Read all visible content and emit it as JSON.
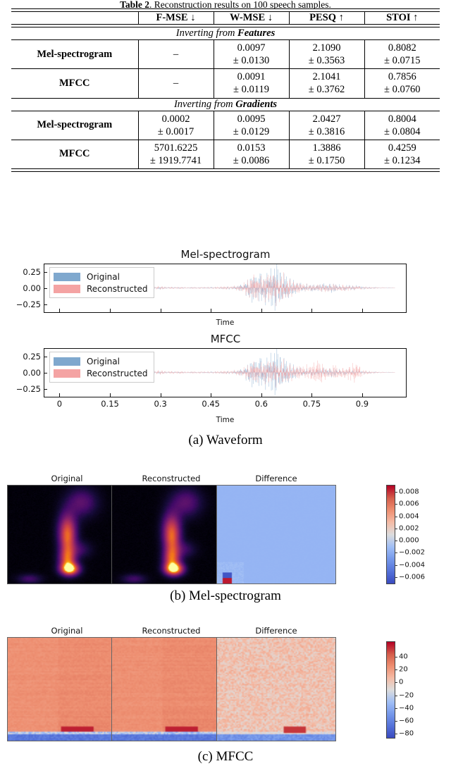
{
  "table": {
    "caption_prefix": "Table 2",
    "caption": "Table 2. Reconstruction results on 100 speech samples.",
    "columns": [
      "",
      "F-MSE ↓",
      "W-MSE ↓",
      "PESQ ↑",
      "STOI ↑"
    ],
    "sections": [
      {
        "header_plain": "Inverting from ",
        "header_bold": "Features",
        "rows": [
          {
            "label": "Mel-spectrogram",
            "cells": [
              {
                "mean": "–",
                "std": ""
              },
              {
                "mean": "0.0097",
                "std": "± 0.0130"
              },
              {
                "mean": "2.1090",
                "std": "± 0.3563"
              },
              {
                "mean": "0.8082",
                "std": "± 0.0715"
              }
            ]
          },
          {
            "label": "MFCC",
            "cells": [
              {
                "mean": "–",
                "std": ""
              },
              {
                "mean": "0.0091",
                "std": "± 0.0119"
              },
              {
                "mean": "2.1041",
                "std": "± 0.3762"
              },
              {
                "mean": "0.7856",
                "std": "± 0.0760"
              }
            ]
          }
        ]
      },
      {
        "header_plain": "Inverting from ",
        "header_bold": "Gradients",
        "rows": [
          {
            "label": "Mel-spectrogram",
            "cells": [
              {
                "mean": "0.0002",
                "std": "± 0.0017"
              },
              {
                "mean": "0.0095",
                "std": "± 0.0129"
              },
              {
                "mean": "2.0427",
                "std": "± 0.3816"
              },
              {
                "mean": "0.8004",
                "std": "± 0.0804"
              }
            ]
          },
          {
            "label": "MFCC",
            "cells": [
              {
                "mean": "5701.6225",
                "std": "± 1919.7741"
              },
              {
                "mean": "0.0153",
                "std": "± 0.0086"
              },
              {
                "mean": "1.3886",
                "std": "± 0.1750"
              },
              {
                "mean": "0.4259",
                "std": "± 0.1234"
              }
            ]
          }
        ]
      }
    ]
  },
  "figure": {
    "panel_a": {
      "caption": "(a) Waveform",
      "plots": [
        {
          "title": "Mel-spectrogram"
        },
        {
          "title": "MFCC"
        }
      ],
      "legend": [
        {
          "label": "Original",
          "color": "#7fa8ce"
        },
        {
          "label": "Reconstructed",
          "color": "#f4a3a3"
        }
      ],
      "xlabel": "Time",
      "yticks": [
        "0.25",
        "0.00",
        "−0.25"
      ],
      "xticks": [
        "0",
        "0.15",
        "0.3",
        "0.45",
        "0.6",
        "0.75",
        "0.9"
      ]
    },
    "panel_b": {
      "caption": "(b) Mel-spectrogram",
      "titles": [
        "Original",
        "Reconstructed",
        "Difference"
      ],
      "colorbar_ticks": [
        "0.008",
        "0.006",
        "0.004",
        "0.002",
        "0.000",
        "−0.002",
        "−0.004",
        "−0.006"
      ]
    },
    "panel_c": {
      "caption": "(c) MFCC",
      "titles": [
        "Original",
        "Reconstructed",
        "Difference"
      ],
      "colorbar_ticks": [
        "40",
        "20",
        "0",
        "−20",
        "−40",
        "−60",
        "−80"
      ]
    }
  },
  "chart_data": [
    {
      "type": "line",
      "id": "waveform-mel",
      "title": "Mel-spectrogram",
      "xlabel": "Time",
      "ylabel": "",
      "xlim": [
        -0.045,
        1.03
      ],
      "ylim": [
        -0.45,
        0.45
      ],
      "xticks": [
        0,
        0.15,
        0.3,
        0.45,
        0.6,
        0.75,
        0.9
      ],
      "yticks": [
        0.25,
        0.0,
        -0.25
      ],
      "grid": false,
      "legend_position": "upper left",
      "series": [
        {
          "name": "Original",
          "color": "#7fa8ce",
          "envelope_x": [
            0.0,
            0.05,
            0.1,
            0.15,
            0.2,
            0.25,
            0.28,
            0.3,
            0.32,
            0.35,
            0.38,
            0.42,
            0.46,
            0.5,
            0.53,
            0.55,
            0.57,
            0.59,
            0.61,
            0.63,
            0.645,
            0.66,
            0.68,
            0.7,
            0.72,
            0.74,
            0.76,
            0.78,
            0.8,
            0.82,
            0.84,
            0.86,
            0.88,
            0.9,
            0.93,
            0.96,
            1.0
          ],
          "envelope_y": [
            0.004,
            0.004,
            0.006,
            0.01,
            0.012,
            0.012,
            0.016,
            0.03,
            0.014,
            0.016,
            0.012,
            0.014,
            0.018,
            0.022,
            0.04,
            0.09,
            0.2,
            0.3,
            0.29,
            0.33,
            0.4,
            0.3,
            0.2,
            0.12,
            0.08,
            0.06,
            0.06,
            0.07,
            0.075,
            0.07,
            0.06,
            0.05,
            0.04,
            0.03,
            0.018,
            0.01,
            0.005
          ]
        },
        {
          "name": "Reconstructed",
          "color": "#f4a3a3",
          "envelope_x": [
            0.0,
            0.05,
            0.1,
            0.15,
            0.2,
            0.25,
            0.28,
            0.3,
            0.32,
            0.35,
            0.38,
            0.42,
            0.46,
            0.5,
            0.53,
            0.55,
            0.57,
            0.59,
            0.61,
            0.63,
            0.645,
            0.66,
            0.68,
            0.7,
            0.72,
            0.74,
            0.76,
            0.78,
            0.8,
            0.82,
            0.84,
            0.86,
            0.88,
            0.9,
            0.93,
            0.96,
            1.0
          ],
          "envelope_y": [
            0.004,
            0.004,
            0.006,
            0.01,
            0.012,
            0.012,
            0.018,
            0.034,
            0.016,
            0.018,
            0.012,
            0.014,
            0.018,
            0.024,
            0.042,
            0.085,
            0.185,
            0.255,
            0.25,
            0.27,
            0.3,
            0.25,
            0.175,
            0.11,
            0.075,
            0.058,
            0.058,
            0.065,
            0.068,
            0.062,
            0.055,
            0.045,
            0.036,
            0.028,
            0.016,
            0.009,
            0.005
          ]
        }
      ]
    },
    {
      "type": "line",
      "id": "waveform-mfcc",
      "title": "MFCC",
      "xlabel": "Time",
      "ylabel": "",
      "xlim": [
        -0.045,
        1.03
      ],
      "ylim": [
        -0.45,
        0.45
      ],
      "xticks": [
        0,
        0.15,
        0.3,
        0.45,
        0.6,
        0.75,
        0.9
      ],
      "yticks": [
        0.25,
        0.0,
        -0.25
      ],
      "grid": false,
      "legend_position": "upper left",
      "series": [
        {
          "name": "Original",
          "color": "#7fa8ce",
          "envelope_x": [
            0.0,
            0.05,
            0.1,
            0.15,
            0.2,
            0.25,
            0.28,
            0.3,
            0.32,
            0.35,
            0.38,
            0.42,
            0.46,
            0.5,
            0.53,
            0.55,
            0.57,
            0.59,
            0.61,
            0.63,
            0.645,
            0.66,
            0.68,
            0.7,
            0.72,
            0.74,
            0.76,
            0.78,
            0.8,
            0.82,
            0.84,
            0.86,
            0.88,
            0.9,
            0.93,
            0.96,
            1.0
          ],
          "envelope_y": [
            0.004,
            0.004,
            0.006,
            0.01,
            0.012,
            0.012,
            0.016,
            0.03,
            0.014,
            0.016,
            0.012,
            0.014,
            0.018,
            0.022,
            0.04,
            0.09,
            0.2,
            0.3,
            0.29,
            0.33,
            0.4,
            0.3,
            0.2,
            0.12,
            0.08,
            0.06,
            0.06,
            0.07,
            0.075,
            0.07,
            0.06,
            0.05,
            0.04,
            0.03,
            0.018,
            0.01,
            0.005
          ]
        },
        {
          "name": "Reconstructed",
          "color": "#f4a3a3",
          "envelope_x": [
            0.0,
            0.05,
            0.1,
            0.15,
            0.2,
            0.25,
            0.28,
            0.3,
            0.32,
            0.35,
            0.38,
            0.42,
            0.46,
            0.5,
            0.53,
            0.55,
            0.57,
            0.59,
            0.61,
            0.63,
            0.645,
            0.66,
            0.685,
            0.7,
            0.72,
            0.745,
            0.765,
            0.785,
            0.8,
            0.825,
            0.845,
            0.865,
            0.885,
            0.9,
            0.93,
            0.96,
            1.0
          ],
          "envelope_y": [
            0.006,
            0.005,
            0.008,
            0.012,
            0.014,
            0.014,
            0.022,
            0.042,
            0.02,
            0.024,
            0.016,
            0.016,
            0.02,
            0.026,
            0.045,
            0.08,
            0.15,
            0.21,
            0.205,
            0.225,
            0.25,
            0.21,
            0.15,
            0.115,
            0.105,
            0.12,
            0.23,
            0.15,
            0.08,
            0.135,
            0.075,
            0.13,
            0.18,
            0.06,
            0.02,
            0.01,
            0.005
          ]
        }
      ]
    },
    {
      "type": "heatmap",
      "id": "mel-original",
      "title": "Original",
      "colormap": "inferno",
      "vmin": 0.0,
      "vmax": 1.0
    },
    {
      "type": "heatmap",
      "id": "mel-reconstructed",
      "title": "Reconstructed",
      "colormap": "inferno",
      "vmin": 0.0,
      "vmax": 1.0
    },
    {
      "type": "heatmap",
      "id": "mel-difference",
      "title": "Difference",
      "colormap": "coolwarm",
      "vmin": -0.007,
      "vmax": 0.009,
      "colorbar_ticks": [
        0.008,
        0.006,
        0.004,
        0.002,
        0.0,
        -0.002,
        -0.004,
        -0.006
      ]
    },
    {
      "type": "heatmap",
      "id": "mfcc-original",
      "title": "Original",
      "colormap": "coolwarm",
      "vmin": -90,
      "vmax": 55
    },
    {
      "type": "heatmap",
      "id": "mfcc-reconstructed",
      "title": "Reconstructed",
      "colormap": "coolwarm",
      "vmin": -90,
      "vmax": 55
    },
    {
      "type": "heatmap",
      "id": "mfcc-difference",
      "title": "Difference",
      "colormap": "coolwarm",
      "vmin": -90,
      "vmax": 55,
      "colorbar_ticks": [
        40,
        20,
        0,
        -20,
        -40,
        -60,
        -80
      ]
    }
  ]
}
